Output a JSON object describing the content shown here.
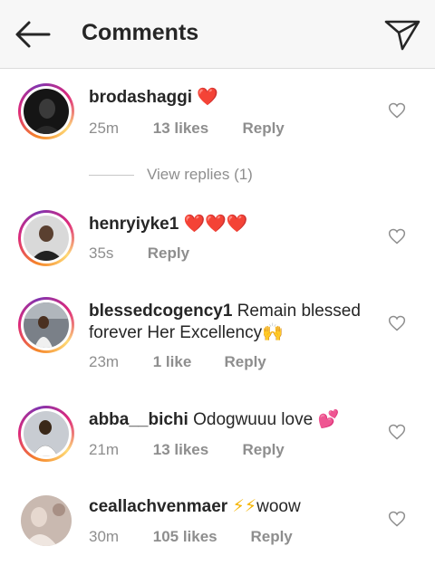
{
  "header": {
    "title": "Comments"
  },
  "comments": [
    {
      "username": "brodashaggi",
      "text": "",
      "emoji": "❤️",
      "time": "25m",
      "likes": "13 likes",
      "reply": "Reply",
      "avatar_ring": true
    },
    {
      "username": "henryiyke1",
      "text": "",
      "emoji": "❤️❤️❤️",
      "time": "35s",
      "likes": "",
      "reply": "Reply",
      "avatar_ring": true
    },
    {
      "username": "blessedcogency1",
      "text": "Remain blessed forever Her Excellency",
      "emoji": "🙌",
      "time": "23m",
      "likes": "1 like",
      "reply": "Reply",
      "avatar_ring": true
    },
    {
      "username": "abba__bichi",
      "text": "Odogwuuu love",
      "emoji": "💕",
      "time": "21m",
      "likes": "13 likes",
      "reply": "Reply",
      "avatar_ring": true
    },
    {
      "username": "ceallachvenmaer",
      "text": "woow",
      "emoji": "⚡⚡",
      "time": "30m",
      "likes": "105 likes",
      "reply": "Reply",
      "avatar_ring": false
    }
  ],
  "view_replies": {
    "label": "View replies (1)"
  },
  "colors": {
    "accent_text": "#262626",
    "muted": "#8e8e8e",
    "heart": "#e0245e"
  }
}
